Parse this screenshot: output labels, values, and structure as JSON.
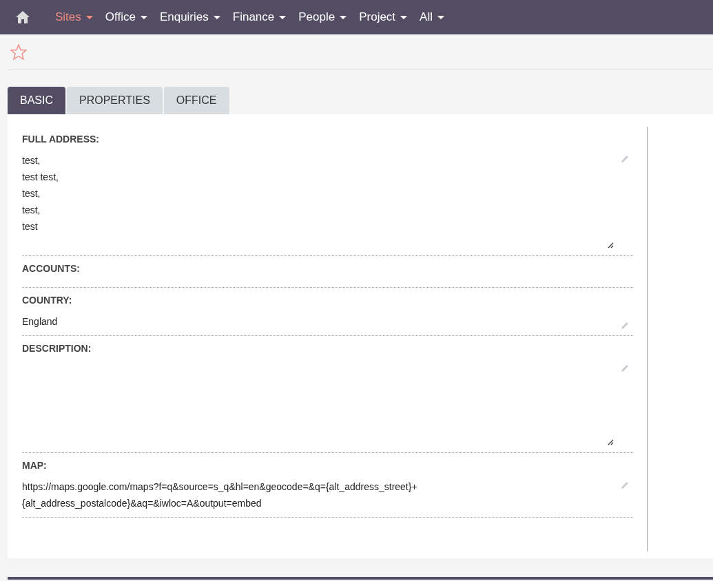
{
  "nav": {
    "items": [
      {
        "label": "Sites",
        "selected": true
      },
      {
        "label": "Office",
        "selected": false
      },
      {
        "label": "Enquiries",
        "selected": false
      },
      {
        "label": "Finance",
        "selected": false
      },
      {
        "label": "People",
        "selected": false
      },
      {
        "label": "Project",
        "selected": false
      },
      {
        "label": "All",
        "selected": false
      }
    ]
  },
  "favorite": {
    "on": false
  },
  "tabs": [
    {
      "label": "BASIC",
      "selected": true
    },
    {
      "label": "PROPERTIES",
      "selected": false
    },
    {
      "label": "OFFICE",
      "selected": false
    }
  ],
  "fields": [
    {
      "label": "FULL ADDRESS:",
      "lines": [
        "test,",
        "test test,",
        "test,",
        "test,",
        "test"
      ],
      "editable": true,
      "resizable": true
    },
    {
      "label": "ACCOUNTS:",
      "editable": false,
      "resizable": false
    },
    {
      "label": "COUNTRY:",
      "lines": [
        "England"
      ],
      "editable": true,
      "resizable": false
    },
    {
      "label": "DESCRIPTION:",
      "editable": true,
      "resizable": true
    },
    {
      "label": "MAP:",
      "lines": [
        "https://maps.google.com/maps?f=q&source=s_q&hl=en&geocode=&q={alt_address_street}+",
        "{alt_address_postalcode}&aq=&iwloc=A&output=embed"
      ],
      "editable": true,
      "resizable": false
    }
  ]
}
